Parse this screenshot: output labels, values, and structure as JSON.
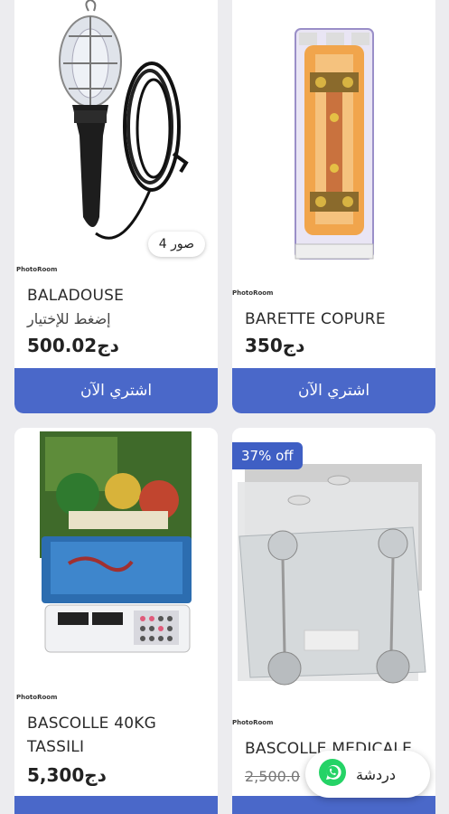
{
  "products": [
    {
      "name": "BALADOUSE",
      "subtitle": "إضغط للإختيار",
      "price": "500.02دج",
      "photo_count": "4 صور",
      "button": "اشتري الآن",
      "watermark": "PhotoRoom"
    },
    {
      "name": "BARETTE COPURE",
      "price": "350دج",
      "button": "اشتري الآن",
      "watermark": "PhotoRoom"
    },
    {
      "name_line1": "BASCOLLE 40KG",
      "name_line2": "TASSILI",
      "price": "5,300دج",
      "watermark": "PhotoRoom"
    },
    {
      "name": "BASCOLLE MEDICALE",
      "old_price": "2,500.0",
      "discount": "37% off",
      "watermark": "PhotoRoom"
    }
  ],
  "chat": {
    "label": "دردشة",
    "icon": "whatsapp-icon"
  },
  "colors": {
    "accent": "#4a68c9",
    "background": "#ececef",
    "whatsapp": "#25d366"
  }
}
